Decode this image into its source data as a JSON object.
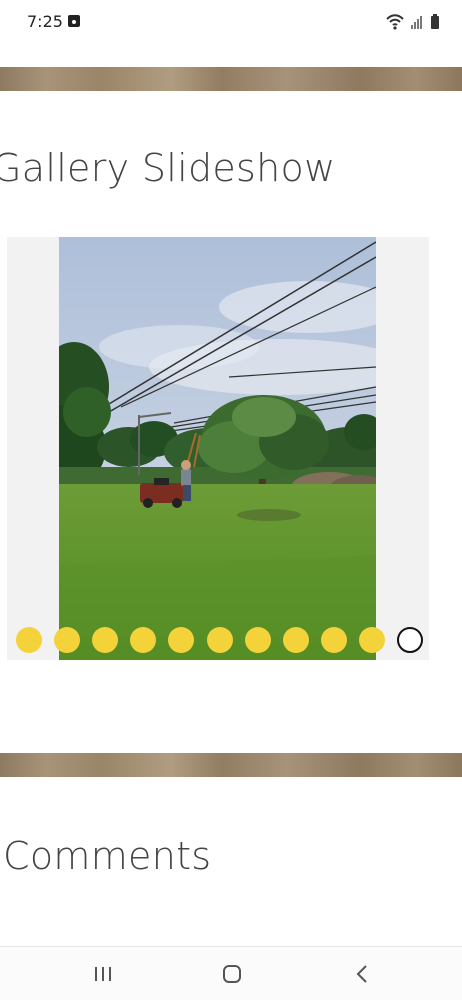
{
  "status_bar": {
    "time": "7:25",
    "icons": [
      "gallery-icon",
      "wifi-icon",
      "signal-icon",
      "battery-icon"
    ]
  },
  "gallery": {
    "title": "Gallery Slideshow",
    "slide_count": 11,
    "active_index": 10,
    "dot_color": "#f4d23a"
  },
  "comments": {
    "title": "Comments"
  },
  "navigation": {
    "recents": "recents-icon",
    "home": "home-icon",
    "back": "back-icon"
  }
}
